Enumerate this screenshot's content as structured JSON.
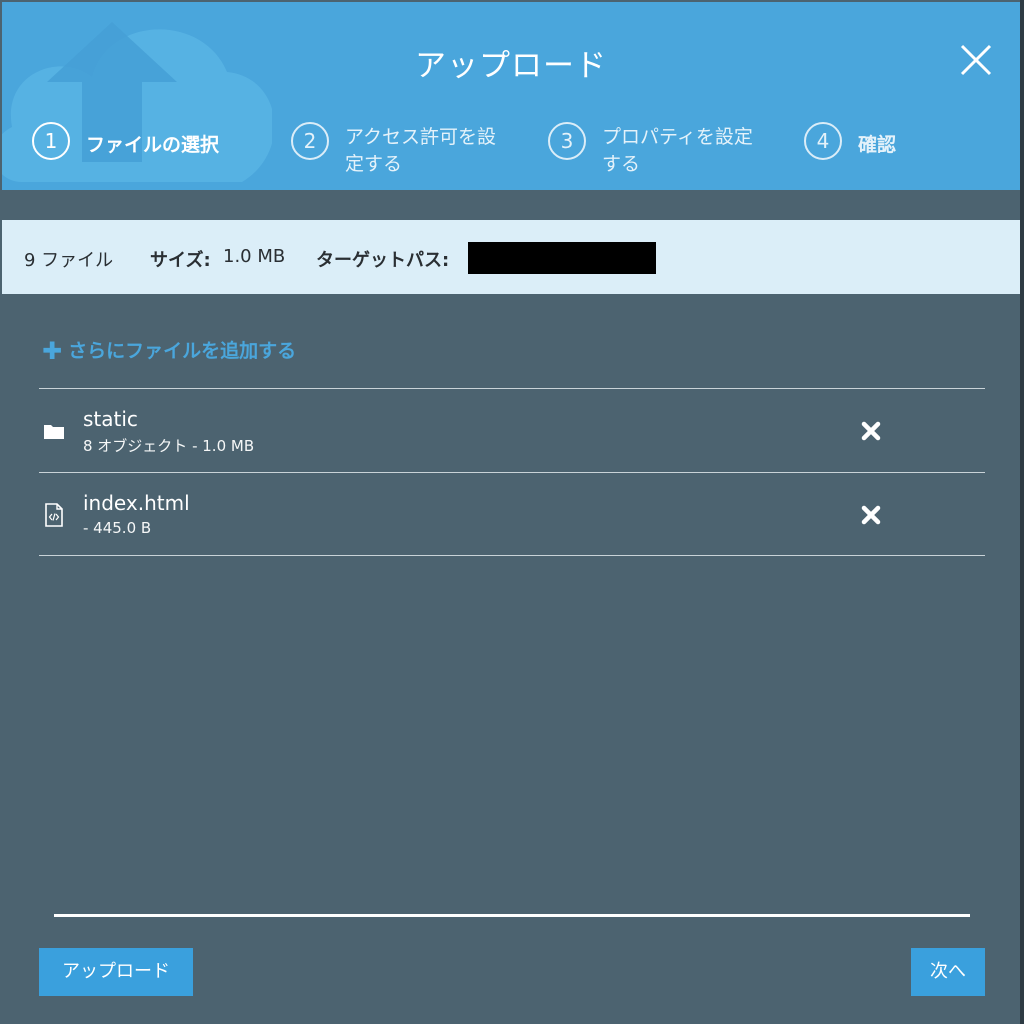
{
  "dialog": {
    "title": "アップロード"
  },
  "steps": [
    {
      "number": "1",
      "label": "ファイルの選択",
      "active": true
    },
    {
      "number": "2",
      "label": "アクセス許可を設定する"
    },
    {
      "number": "3",
      "label": "プロパティを設定する"
    },
    {
      "number": "4",
      "label": "確認"
    }
  ],
  "summary": {
    "file_count": "9 ファイル",
    "size_label": "サイズ:",
    "size_value": "1.0 MB",
    "target_path_label": "ターゲットパス:"
  },
  "add_files_label": "さらにファイルを追加する",
  "files": [
    {
      "name": "static",
      "meta": "8 オブジェクト - 1.0 MB",
      "icon": "folder-icon"
    },
    {
      "name": "index.html",
      "meta": "- 445.0 B",
      "icon": "code-file-icon"
    }
  ],
  "upload_progress": 1.0,
  "footer": {
    "upload_button": "アップロード",
    "next_button": "次へ"
  },
  "colors": {
    "header": "#4aa6dc",
    "body": "#4c6370",
    "info_bar": "#dbeef8",
    "accent": "#3aa0dd"
  }
}
